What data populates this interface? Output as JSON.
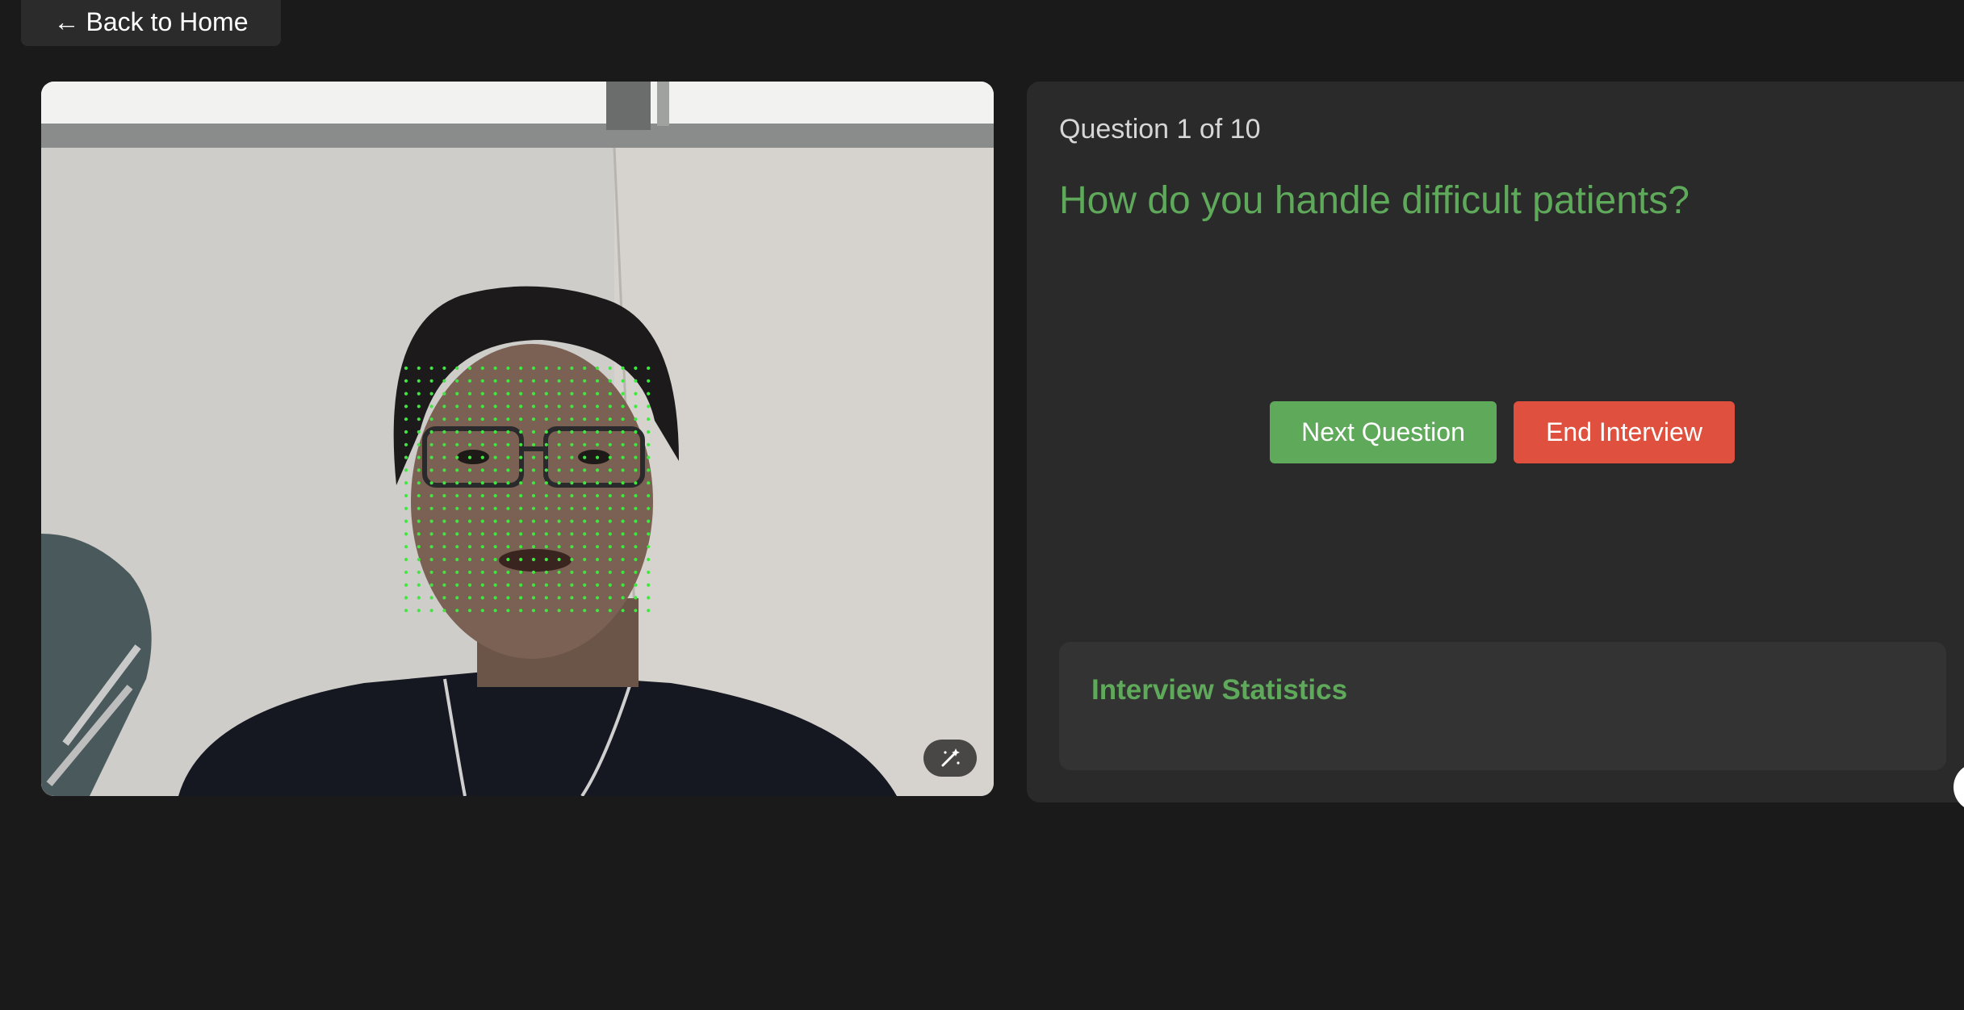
{
  "nav": {
    "back_arrow": "←",
    "back_label": "Back to Home"
  },
  "video": {
    "effects_icon": "magic-wand-icon",
    "face_mesh_color": "#3ee83e"
  },
  "question": {
    "counter": "Question 1 of 10",
    "text": "How do you handle difficult patients?"
  },
  "actions": {
    "next_label": "Next Question",
    "end_label": "End Interview"
  },
  "stats": {
    "title": "Interview Statistics"
  },
  "colors": {
    "background": "#1a1a1a",
    "panel": "#2a2a2a",
    "accent_green": "#5fa95b",
    "danger_red": "#e0503f"
  }
}
